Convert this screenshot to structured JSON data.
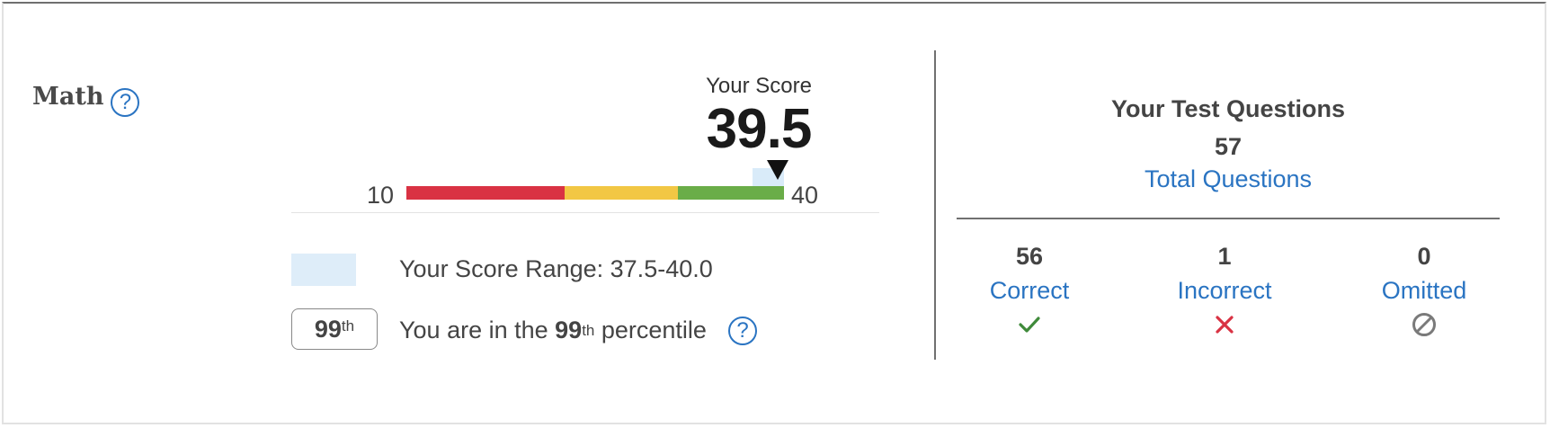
{
  "section": {
    "title": "Math",
    "help_icon": "question-circle-icon"
  },
  "score": {
    "label": "Your Score",
    "value": "39.5",
    "scale_min": "10",
    "scale_max": "40",
    "range_low": 37.5,
    "range_high": 40.0,
    "bands": [
      {
        "name": "red",
        "color": "#d93243"
      },
      {
        "name": "yellow",
        "color": "#f2c744"
      },
      {
        "name": "green",
        "color": "#6aad48"
      }
    ]
  },
  "legend": {
    "range_label": "Your Score Range: 37.5-40.0",
    "percentile_badge_num": "99",
    "percentile_badge_sup": "th",
    "percentile_prefix": "You are in the ",
    "percentile_num": "99",
    "percentile_sup": "th",
    "percentile_suffix": " percentile",
    "help_icon": "question-circle-icon"
  },
  "questions": {
    "title": "Your Test Questions",
    "total": "57",
    "total_label": "Total Questions",
    "stats": [
      {
        "count": "56",
        "label": "Correct",
        "icon": "check-icon",
        "color": "#3f8a3a"
      },
      {
        "count": "1",
        "label": "Incorrect",
        "icon": "x-icon",
        "color": "#d93243"
      },
      {
        "count": "0",
        "label": "Omitted",
        "icon": "omitted-icon",
        "color": "#7a7a7a"
      }
    ]
  },
  "colors": {
    "accent": "#2a74c2",
    "range_fill": "#d9ebf9"
  }
}
